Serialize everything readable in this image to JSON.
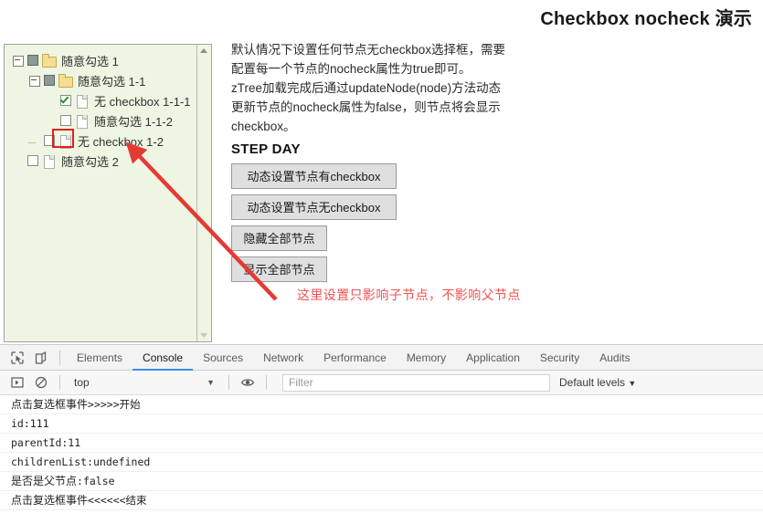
{
  "page": {
    "title": "Checkbox nocheck 演示",
    "description_lines": [
      "默认情况下设置任何节点无checkbox选择框，需要",
      "配置每一个节点的nocheck属性为true即可。",
      "zTree加载完成后通过updateNode(node)方法动态",
      "更新节点的nocheck属性为false，则节点将会显示",
      "checkbox。"
    ],
    "step_heading": "STEP DAY",
    "buttons": [
      {
        "label": "动态设置节点有checkbox",
        "size": "wide"
      },
      {
        "label": "动态设置节点无checkbox",
        "size": "wide"
      },
      {
        "label": "隐藏全部节点",
        "size": "narrow"
      },
      {
        "label": "显示全部节点",
        "size": "narrow"
      }
    ],
    "annotation": {
      "text": "这里设置只影响子节点，不影响父节点",
      "color": "#ef5350"
    },
    "highlight_color": "#e02020"
  },
  "tree": {
    "nodes": [
      {
        "label": "随意勾选 1",
        "level": 1,
        "switch": "minus",
        "check": "partial",
        "icon": "folder"
      },
      {
        "label": "随意勾选 1-1",
        "level": 2,
        "switch": "minus",
        "check": "partial",
        "icon": "folder"
      },
      {
        "label": "无 checkbox 1-1-1",
        "level": 3,
        "switch": "blank",
        "check": "checked",
        "icon": "file"
      },
      {
        "label": "随意勾选 1-1-2",
        "level": 3,
        "switch": "blank",
        "check": "unchecked",
        "icon": "file"
      },
      {
        "label": "无 checkbox 1-2",
        "level": 2,
        "switch": "leafline",
        "check": "unchecked",
        "icon": "file"
      },
      {
        "label": "随意勾选 2",
        "level": 1,
        "switch": "blank",
        "check": "unchecked",
        "icon": "file"
      }
    ]
  },
  "devtools": {
    "tabs": [
      {
        "label": "Elements",
        "active": false
      },
      {
        "label": "Console",
        "active": true
      },
      {
        "label": "Sources",
        "active": false
      },
      {
        "label": "Network",
        "active": false
      },
      {
        "label": "Performance",
        "active": false
      },
      {
        "label": "Memory",
        "active": false
      },
      {
        "label": "Application",
        "active": false
      },
      {
        "label": "Security",
        "active": false
      },
      {
        "label": "Audits",
        "active": false
      }
    ],
    "active_tab_color": "#3a8ee6",
    "context_selector": "top",
    "filter_placeholder": "Filter",
    "levels_selector": "Default levels",
    "console_lines": [
      {
        "text": "点击复选框事件>>>>>开始",
        "style": "mixed"
      },
      {
        "text": "id:111",
        "style": "mono"
      },
      {
        "text": "parentId:11",
        "style": "mono"
      },
      {
        "text": "childrenList:undefined",
        "style": "mono"
      },
      {
        "text": "是否是父节点:false",
        "style": "mixed"
      },
      {
        "text": "点击复选框事件<<<<<<结束",
        "style": "mixed"
      }
    ]
  }
}
